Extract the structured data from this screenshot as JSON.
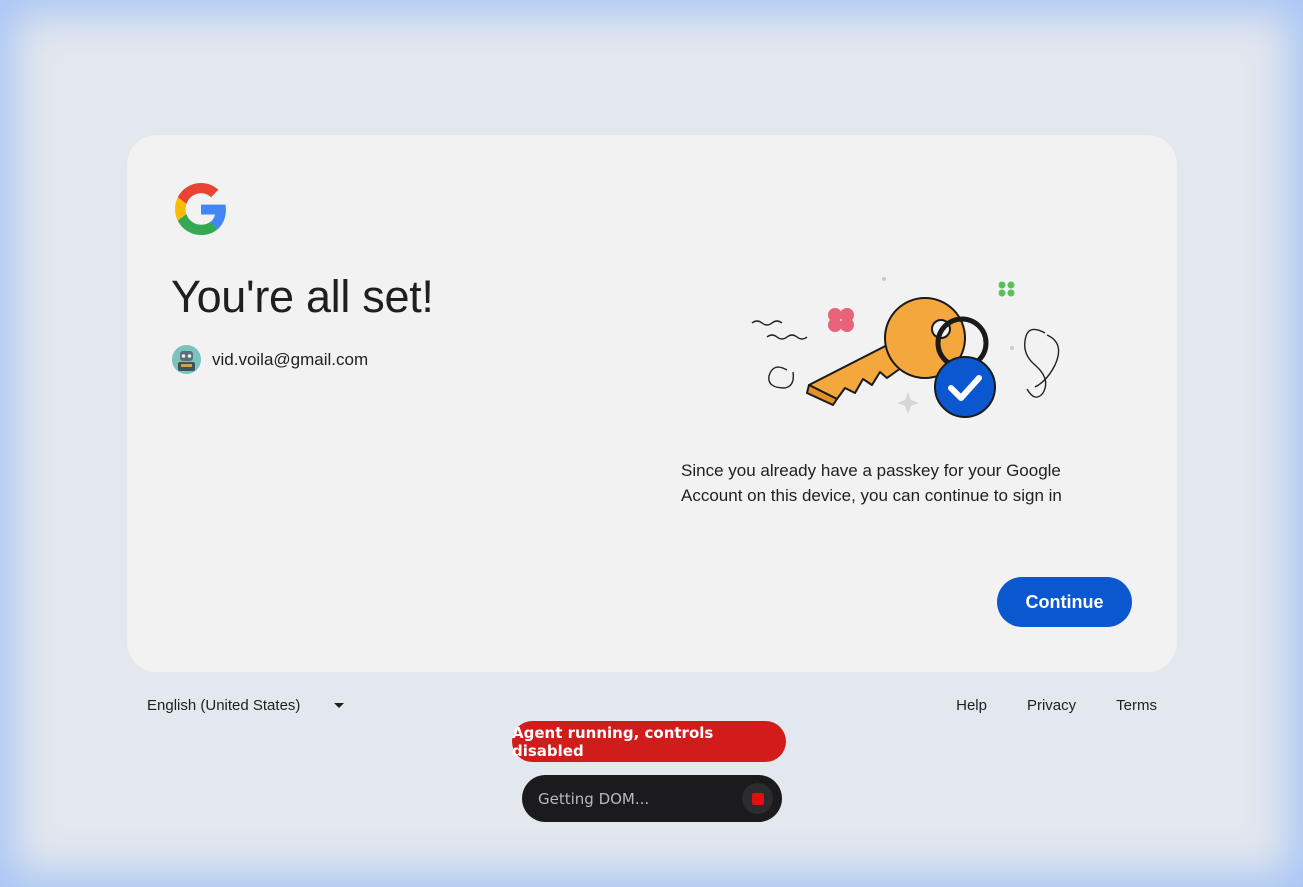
{
  "card": {
    "title": "You're all set!",
    "email": "vid.voila@gmail.com",
    "description_line1": "Since you already have a passkey for your Google",
    "description_line2": "Account on this device, you can continue to sign in",
    "continue_label": "Continue"
  },
  "footer": {
    "language": "English (United States)",
    "help": "Help",
    "privacy": "Privacy",
    "terms": "Terms"
  },
  "agent": {
    "badge": "Agent running, controls disabled",
    "status": "Getting DOM..."
  },
  "colors": {
    "primary_button": "#0b57d0",
    "agent_badge": "#d21b1b",
    "key": "#f4a73c",
    "check_badge": "#0b57d0"
  },
  "icons": [
    "google-logo-icon",
    "avatar",
    "passkey-illustration",
    "checkmark-icon",
    "chevron-down-icon",
    "stop-icon"
  ]
}
